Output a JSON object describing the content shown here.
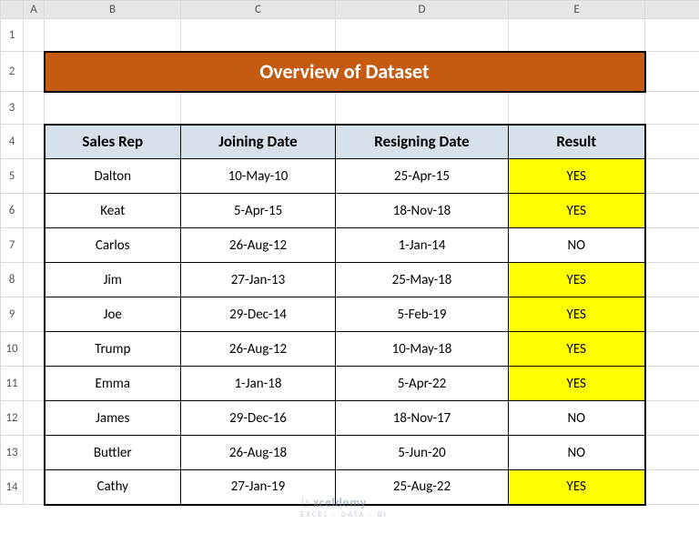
{
  "col_letters": {
    "A": "A",
    "B": "B",
    "C": "C",
    "D": "D",
    "E": "E"
  },
  "rows": [
    "1",
    "2",
    "3",
    "4",
    "5",
    "6",
    "7",
    "8",
    "9",
    "10",
    "11",
    "12",
    "13",
    "14"
  ],
  "title": "Overview of Dataset",
  "headers": {
    "sales_rep": "Sales Rep",
    "joining": "Joining Date",
    "resigning": "Resigning Date",
    "result": "Result"
  },
  "data": [
    {
      "rep": "Dalton",
      "join": "10-May-10",
      "resign": "25-Apr-15",
      "res": "YES",
      "hl": true
    },
    {
      "rep": "Keat",
      "join": "5-Apr-15",
      "resign": "18-Nov-18",
      "res": "YES",
      "hl": true
    },
    {
      "rep": "Carlos",
      "join": "26-Aug-12",
      "resign": "1-Jan-14",
      "res": "NO",
      "hl": false
    },
    {
      "rep": "Jim",
      "join": "27-Jan-13",
      "resign": "25-May-18",
      "res": "YES",
      "hl": true
    },
    {
      "rep": "Joe",
      "join": "29-Dec-14",
      "resign": "5-Feb-19",
      "res": "YES",
      "hl": true
    },
    {
      "rep": "Trump",
      "join": "26-Aug-12",
      "resign": "10-May-18",
      "res": "YES",
      "hl": true
    },
    {
      "rep": "Emma",
      "join": "1-Jan-18",
      "resign": "5-Apr-22",
      "res": "YES",
      "hl": true
    },
    {
      "rep": "James",
      "join": "29-Dec-16",
      "resign": "18-Nov-17",
      "res": "NO",
      "hl": false
    },
    {
      "rep": "Buttler",
      "join": "26-Aug-18",
      "resign": "5-Jun-20",
      "res": "NO",
      "hl": false
    },
    {
      "rep": "Cathy",
      "join": "27-Jan-19",
      "resign": "25-Aug-22",
      "res": "YES",
      "hl": true
    }
  ],
  "watermark": {
    "brand": "xceldemy",
    "tagline": "EXCEL · DATA · BI"
  }
}
